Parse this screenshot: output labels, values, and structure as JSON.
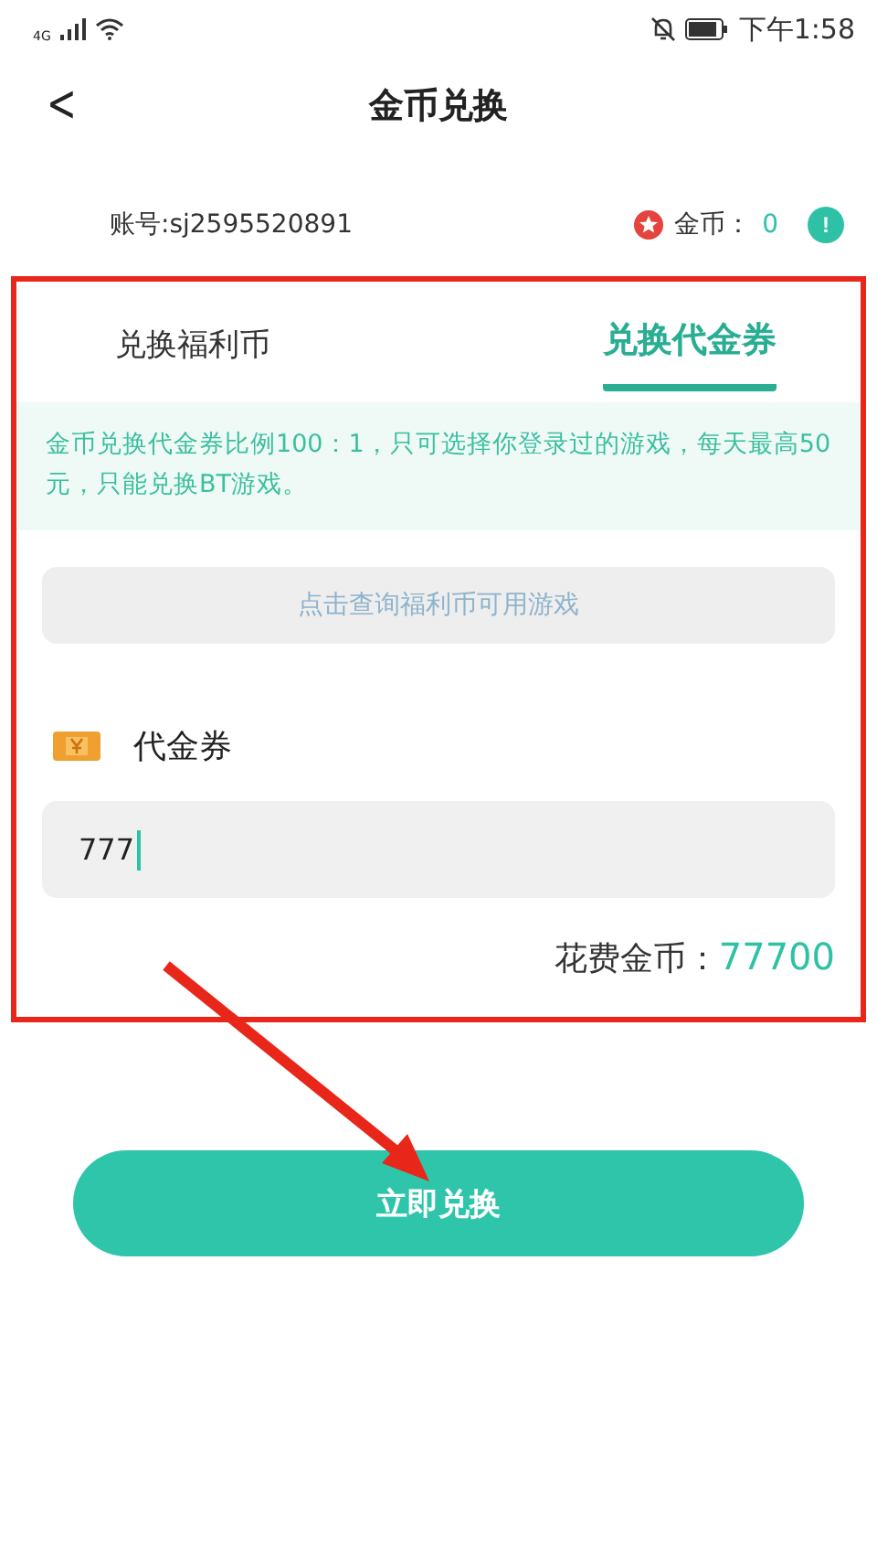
{
  "status_bar": {
    "network": "4G",
    "time": "下午1:58"
  },
  "header": {
    "back": "<",
    "title": "金币兑换"
  },
  "account": {
    "label": "账号:sj2595520891",
    "coins_label": "金币：",
    "coins_value": "0",
    "info": "!"
  },
  "tabs": [
    {
      "label": "兑换福利币",
      "selected": false
    },
    {
      "label": "兑换代金券",
      "selected": true
    }
  ],
  "notice": "金币兑换代金券比例100：1，只可选择你登录过的游戏，每天最高50元，只能兑换BT游戏。",
  "query_button": "点击查询福利币可用游戏",
  "voucher": {
    "label": "代金券",
    "value": "777"
  },
  "cost": {
    "label": "花费金币：",
    "value": "77700"
  },
  "submit": "立即兑换"
}
